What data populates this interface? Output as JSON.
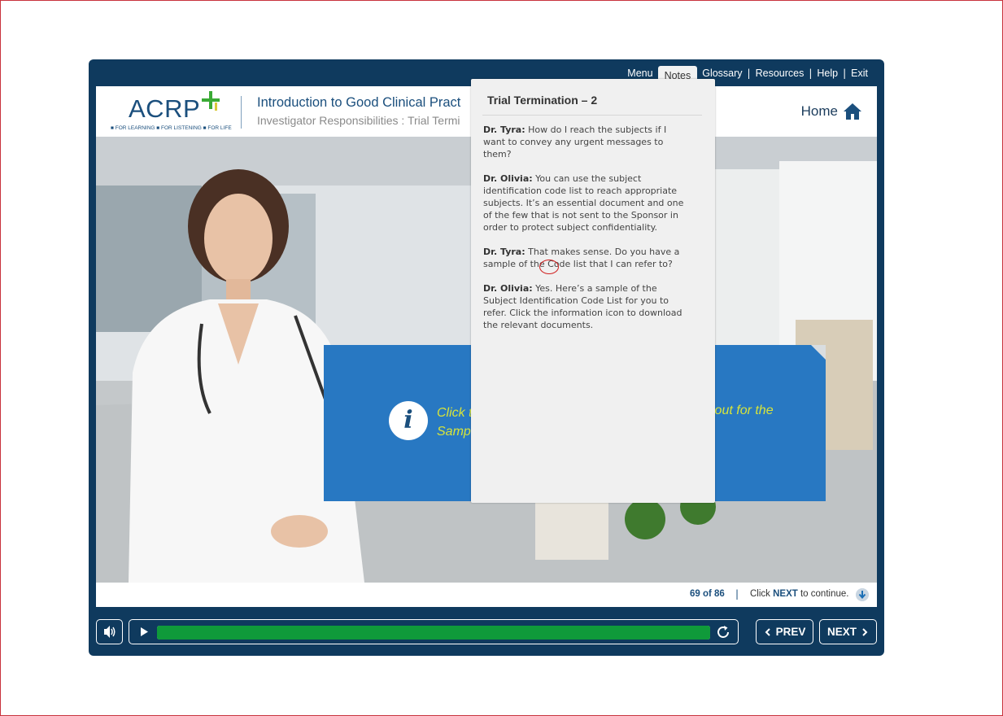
{
  "topnav": {
    "menu": "Menu",
    "notes": "Notes",
    "glossary": "Glossary",
    "resources": "Resources",
    "help": "Help",
    "exit": "Exit",
    "separator": "|"
  },
  "header": {
    "logo_text": "ACRP",
    "logo_tagline": "■ FOR LEARNING ■ FOR LISTENING ■ FOR LIFE",
    "course_title": "Introduction to Good Clinical Pract",
    "course_subtitle": "Investigator Responsibilities : Trial Termi",
    "home_label": "Home"
  },
  "stage": {
    "info_text_line1": "Click t",
    "info_text_line2": "Samp",
    "info_text_right": "lout for the",
    "info_icon_glyph": "i"
  },
  "footer": {
    "page_count": "69 of 86",
    "pipe": "|",
    "continue_prefix": "Click ",
    "continue_bold": "NEXT",
    "continue_suffix": " to continue."
  },
  "controls": {
    "prev_label": "PREV",
    "next_label": "NEXT",
    "progress": 1.0
  },
  "notes": {
    "title": "Trial Termination – 2",
    "entries": [
      {
        "speaker": "Dr. Tyra:",
        "text": " How do I reach the subjects if I want to convey any urgent messages to them?"
      },
      {
        "speaker": "Dr. Olivia:",
        "text": " You can use the subject identification code list to reach appropriate subjects. It’s an essential document and one of the few that is not sent to the Sponsor in order to protect subject confidentiality."
      },
      {
        "speaker": "Dr. Tyra:",
        "text": " That makes sense. Do you have a sample of the Code list that I can refer to?"
      },
      {
        "speaker": "Dr. Olivia:",
        "text": " Yes. Here’s a sample of the Subject Identification Code List for you to refer. Click the information icon to download the relevant documents."
      }
    ]
  },
  "colors": {
    "frame": "#0f3a5e",
    "brand_blue": "#1b4f7d",
    "panel_blue": "#2878c2",
    "progress_green": "#0f9a3a",
    "info_text": "#d8e43a",
    "logo_cross_green": "#3aaa35"
  },
  "icons": [
    "home-icon",
    "volume-icon",
    "play-icon",
    "replay-icon",
    "chevron-left-icon",
    "chevron-right-icon",
    "download-arrow-icon",
    "info-icon"
  ]
}
